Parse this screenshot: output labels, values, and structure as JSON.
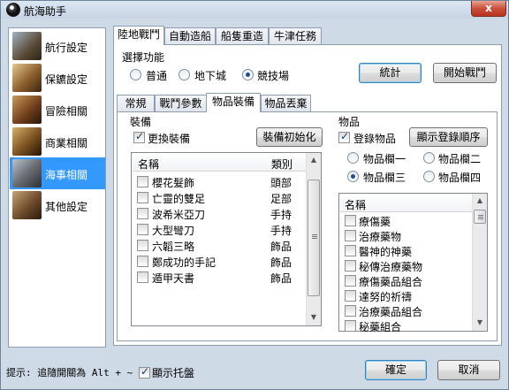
{
  "window": {
    "title": "航海助手",
    "close_label": "x"
  },
  "sidebar": {
    "items": [
      {
        "label": "航行設定",
        "icon": "ship-icon",
        "selected": false
      },
      {
        "label": "保鑣設定",
        "icon": "guard-icon",
        "selected": false
      },
      {
        "label": "冒險相關",
        "icon": "adventure-icon",
        "selected": false
      },
      {
        "label": "商業相關",
        "icon": "trade-icon",
        "selected": false
      },
      {
        "label": "海事相關",
        "icon": "marine-icon",
        "selected": true
      },
      {
        "label": "其他設定",
        "icon": "other-icon",
        "selected": false
      }
    ]
  },
  "top_tabs": [
    "陸地戰鬥",
    "自動造船",
    "船隻重造",
    "牛津任務"
  ],
  "mode": {
    "title": "選擇功能",
    "options": [
      "普通",
      "地下城",
      "競技場"
    ],
    "selected": 2
  },
  "buttons": {
    "stats": "統計",
    "start": "開始戰鬥",
    "ok": "確定",
    "cancel": "取消"
  },
  "sub_tabs": [
    "常規",
    "戰鬥參數",
    "物品裝備",
    "物品丟棄"
  ],
  "equip": {
    "title": "裝備",
    "switch_label": "更換裝備",
    "switch_checked": true,
    "init_button": "裝備初始化",
    "col_name": "名稱",
    "col_type": "類別",
    "rows": [
      {
        "name": "櫻花髮飾",
        "type": "頭部"
      },
      {
        "name": "亡靈的雙足",
        "type": "足部"
      },
      {
        "name": "波希米亞刀",
        "type": "手持"
      },
      {
        "name": "大型彎刀",
        "type": "手持"
      },
      {
        "name": "六韜三略",
        "type": "飾品"
      },
      {
        "name": "鄭成功的手記",
        "type": "飾品"
      },
      {
        "name": "遁甲天書",
        "type": "飾品"
      }
    ]
  },
  "items": {
    "title": "物品",
    "login_label": "登錄物品",
    "login_checked": true,
    "order_button": "顯示登錄順序",
    "slots": [
      "物品欄一",
      "物品欄二",
      "物品欄三",
      "物品欄四"
    ],
    "slot_selected": 2,
    "col_name": "名稱",
    "rows": [
      "療傷藥",
      "治療藥物",
      "醫神的神藥",
      "秘傳治療藥物",
      "療傷藥品組合",
      "達努的祈禱",
      "治療藥品組合",
      "秘藥組合"
    ]
  },
  "footer": {
    "hint": "提示: 追隨開關為 Alt + ~",
    "tray_label": "顯示托盤",
    "tray_checked": true
  }
}
